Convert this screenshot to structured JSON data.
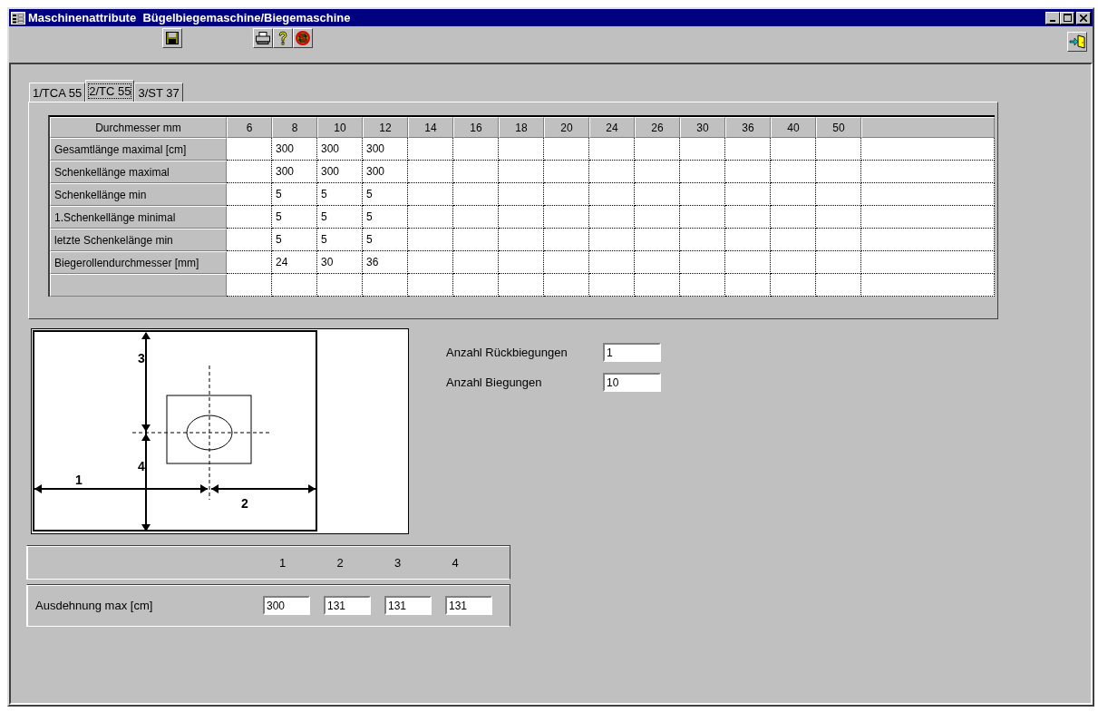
{
  "window": {
    "title": "Maschinenattribute  Bügelbiegemaschine/Biegemaschine"
  },
  "tabs": [
    {
      "label": "1/TCA 55",
      "selected": false
    },
    {
      "label": "2/TC 55",
      "selected": true
    },
    {
      "label": "3/ST 37",
      "selected": false
    }
  ],
  "grid": {
    "corner": "Durchmesser mm",
    "columns": [
      "6",
      "8",
      "10",
      "12",
      "14",
      "16",
      "18",
      "20",
      "24",
      "26",
      "30",
      "36",
      "40",
      "50"
    ],
    "rows": [
      {
        "label": "Gesamtlänge maximal [cm]",
        "cells": [
          null,
          "300",
          "300",
          "300"
        ]
      },
      {
        "label": "Schenkellänge maximal",
        "cells": [
          null,
          "300",
          "300",
          "300"
        ]
      },
      {
        "label": "Schenkellänge min",
        "cells": [
          null,
          "5",
          "5",
          "5"
        ]
      },
      {
        "label": "1.Schenkellänge minimal",
        "cells": [
          null,
          "5",
          "5",
          "5"
        ]
      },
      {
        "label": "letzte Schenkelänge min",
        "cells": [
          null,
          "5",
          "5",
          "5"
        ]
      },
      {
        "label": "Biegerollendurchmesser [mm]",
        "cells": [
          null,
          "24",
          "30",
          "36"
        ]
      }
    ]
  },
  "drawing": {
    "labels": [
      "1",
      "2",
      "3",
      "4"
    ]
  },
  "fields": [
    {
      "label": "Anzahl Rückbiegungen",
      "value": "1"
    },
    {
      "label": "Anzahl Biegungen",
      "value": "10"
    }
  ],
  "extent": {
    "columns": [
      "1",
      "2",
      "3",
      "4"
    ],
    "label": "Ausdehnung max [cm]",
    "values": [
      "300",
      "131",
      "131",
      "131"
    ]
  }
}
